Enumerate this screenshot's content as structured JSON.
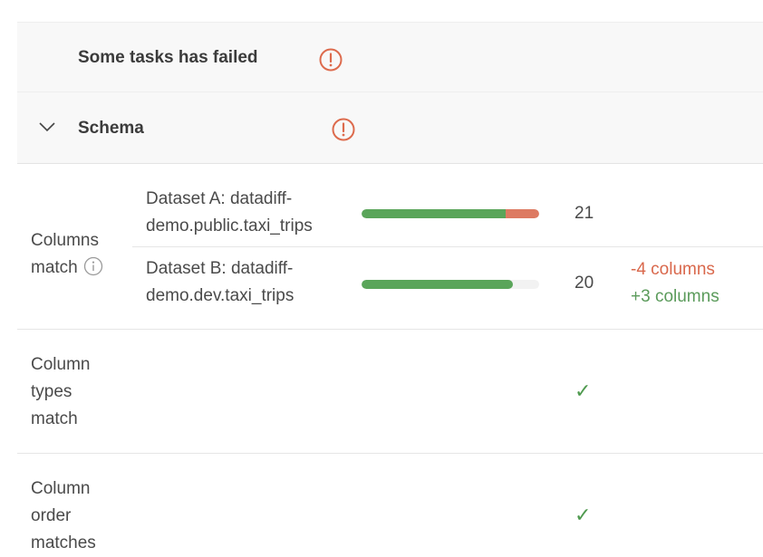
{
  "status": {
    "title": "Some tasks has failed",
    "icon": "alert-circle-icon"
  },
  "schema": {
    "title": "Schema",
    "expanded": true,
    "icon": "alert-circle-icon"
  },
  "columns_match": {
    "label_line1": "Columns",
    "label_line2": "match",
    "datasets": [
      {
        "name_line1": "Dataset A: datadiff-",
        "name_line2": "demo.public.taxi_trips",
        "count": "21",
        "bar_matched_fraction": 0.81,
        "bar_mismatched_fraction": 0.19
      },
      {
        "name_line1": "Dataset B: datadiff-",
        "name_line2": "demo.dev.taxi_trips",
        "count": "20",
        "bar_matched_fraction": 0.85,
        "bar_mismatched_fraction": 0.0,
        "removed": "-4 columns",
        "added": "+3 columns"
      }
    ]
  },
  "column_types_match": {
    "label_line1": "Column",
    "label_line2": "types",
    "label_line3": "match",
    "status": "✓"
  },
  "column_order_matches": {
    "label_line1": "Column",
    "label_line2": "order",
    "label_line3": "matches",
    "status": "✓"
  },
  "colors": {
    "error": "#dd6b4d",
    "success": "#5aa55a"
  }
}
